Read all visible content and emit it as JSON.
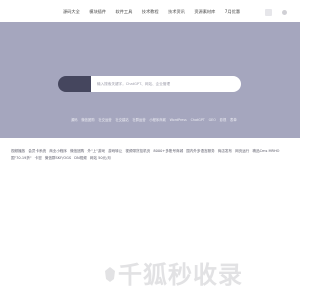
{
  "nav": {
    "items": [
      "源码大全",
      "模块插件",
      "软件工具",
      "技术教程",
      "技术资讯",
      "资源素材库",
      "7月优惠"
    ]
  },
  "hero": {
    "search_placeholder": "输入搜索关键字，ChatGPT、网站、企业管理",
    "tags": [
      "源码",
      "微信团购",
      "社交运营",
      "社交建站",
      "社群运营",
      "小程序商城",
      "WordPress",
      "ChatGPT",
      "GEO",
      "影视",
      "表单"
    ]
  },
  "content": {
    "links": [
      "视频播放",
      "会员卡系统",
      "商业小程序",
      "微信团购",
      "外\"上\"游戏",
      "游戏转让",
      "视频带货挂机页",
      "8000+多账号商城",
      "国内外多语言服务",
      "商店发布",
      "网页运行",
      "精品Cms MRHO",
      "国\"70.19折\"",
      "卡密",
      "微信群SKF/OGS",
      "DN视频",
      "网站 50元/月"
    ]
  },
  "watermark": {
    "text": "千狐秒收录"
  },
  "colors": {
    "hero_bg": "#a5a6be",
    "search_button": "#45465e",
    "watermark": "#e2e2e4"
  }
}
